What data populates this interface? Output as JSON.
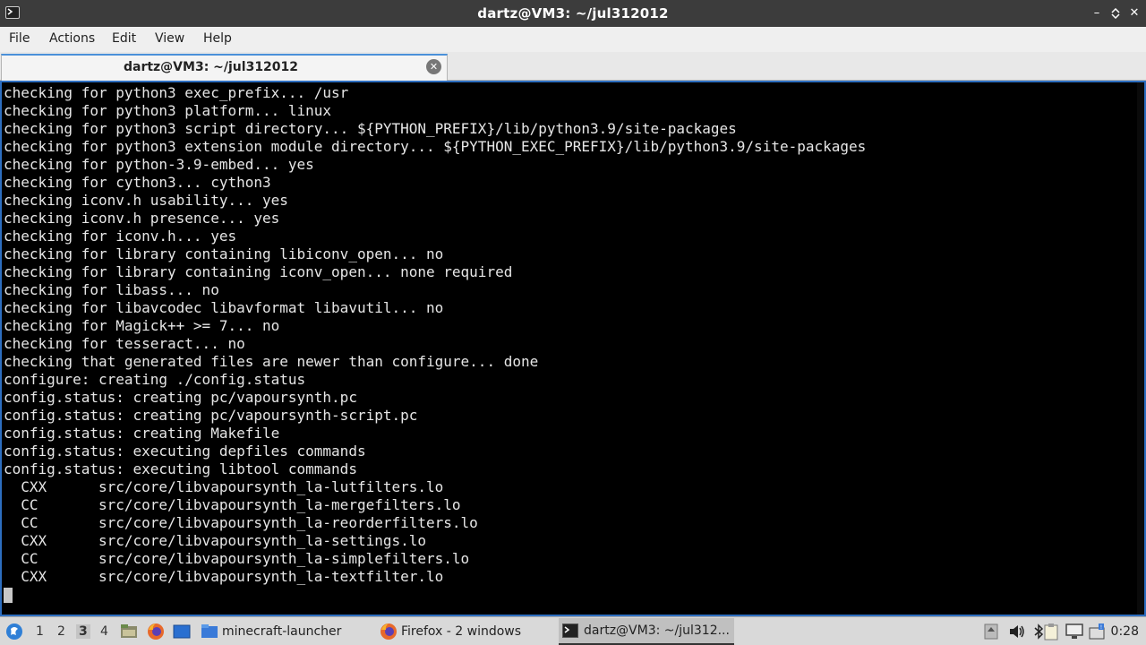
{
  "window": {
    "title": "dartz@VM3: ~/jul312012"
  },
  "menu": [
    "File",
    "Actions",
    "Edit",
    "View",
    "Help"
  ],
  "tab": {
    "label": "dartz@VM3: ~/jul312012"
  },
  "terminal": {
    "lines": [
      "checking for python3 exec_prefix... /usr",
      "checking for python3 platform... linux",
      "checking for python3 script directory... ${PYTHON_PREFIX}/lib/python3.9/site-packages",
      "checking for python3 extension module directory... ${PYTHON_EXEC_PREFIX}/lib/python3.9/site-packages",
      "checking for python-3.9-embed... yes",
      "checking for cython3... cython3",
      "checking iconv.h usability... yes",
      "checking iconv.h presence... yes",
      "checking for iconv.h... yes",
      "checking for library containing libiconv_open... no",
      "checking for library containing iconv_open... none required",
      "checking for libass... no",
      "checking for libavcodec libavformat libavutil... no",
      "checking for Magick++ >= 7... no",
      "checking for tesseract... no",
      "checking that generated files are newer than configure... done",
      "configure: creating ./config.status",
      "config.status: creating pc/vapoursynth.pc",
      "config.status: creating pc/vapoursynth-script.pc",
      "config.status: creating Makefile",
      "config.status: executing depfiles commands",
      "config.status: executing libtool commands",
      "  CXX      src/core/libvapoursynth_la-lutfilters.lo",
      "  CC       src/core/libvapoursynth_la-mergefilters.lo",
      "  CC       src/core/libvapoursynth_la-reorderfilters.lo",
      "  CXX      src/core/libvapoursynth_la-settings.lo",
      "  CC       src/core/libvapoursynth_la-simplefilters.lo",
      "  CXX      src/core/libvapoursynth_la-textfilter.lo"
    ]
  },
  "taskbar": {
    "workspaces": [
      "1",
      "2",
      "3",
      "4"
    ],
    "active_workspace": "3",
    "tasks": [
      {
        "label": "minecraft-launcher",
        "icon": "folder-icon"
      },
      {
        "label": "Firefox - 2 windows",
        "icon": "firefox-icon"
      },
      {
        "label": "dartz@VM3: ~/jul312...",
        "icon": "terminal-icon"
      }
    ],
    "clock": "0:28"
  },
  "colors": {
    "terminal_bg": "#000000",
    "terminal_fg": "#e6e6e6",
    "titlebar_bg": "#3c3c3c",
    "accent": "#2d6ec0"
  }
}
